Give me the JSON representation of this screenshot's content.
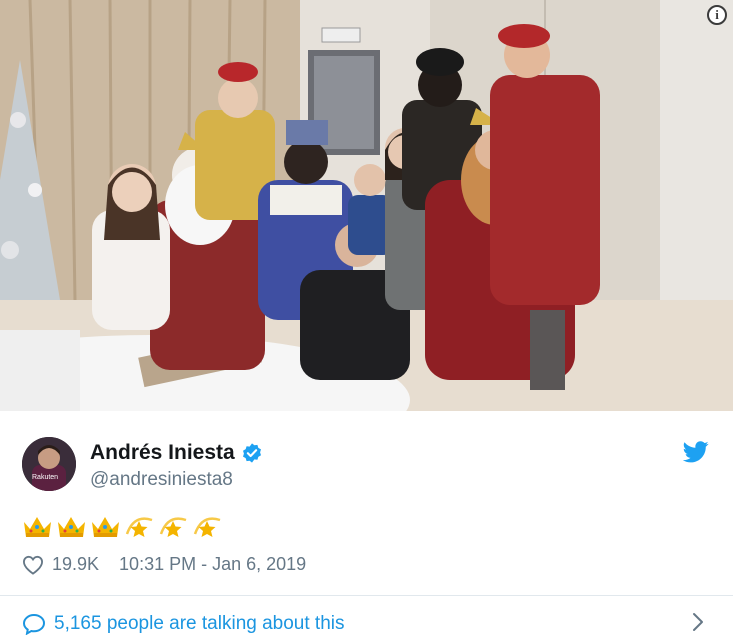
{
  "tweet": {
    "author_name": "Andrés Iniesta",
    "author_handle": "@andresiniesta8",
    "avatar_badge": "Rakuten",
    "emoji": [
      "crown-emoji",
      "crown-emoji",
      "crown-emoji",
      "dizzy-star-emoji",
      "dizzy-star-emoji",
      "dizzy-star-emoji"
    ],
    "like_count": "19.9K",
    "timestamp": "10:31 PM - Jan 6, 2019",
    "conversation_text": "5,165 people are talking about this"
  },
  "photo": {
    "info_label": "i",
    "alt": "Family photo with the Three Kings"
  },
  "colors": {
    "twitter_blue": "#1da1f2",
    "link_blue": "#1b95e0",
    "meta_gray": "#657786",
    "divider": "#e1e8ed"
  }
}
